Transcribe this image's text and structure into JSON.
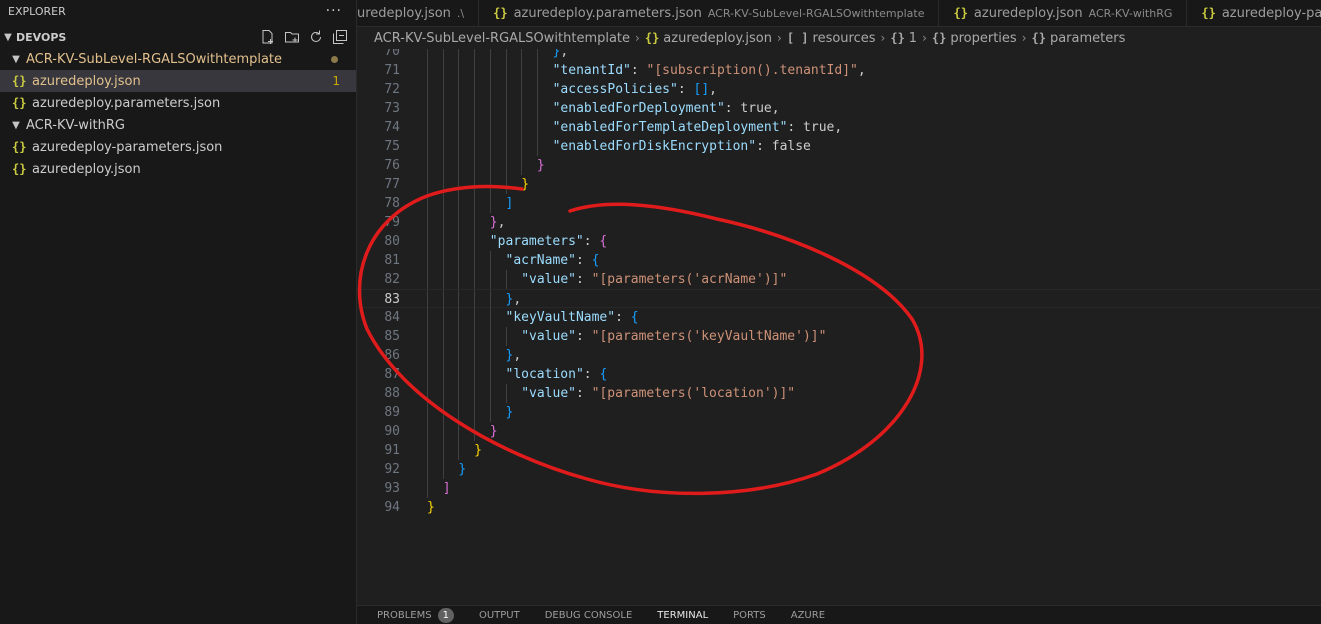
{
  "sidebar": {
    "title": "EXPLORER",
    "more": "···",
    "section": "DEVOPS",
    "tree": [
      {
        "kind": "folder",
        "label": "ACR-KV-SubLevel-RGALSOwithtemplate",
        "modified": true
      },
      {
        "kind": "file",
        "label": "azuredeploy.json",
        "badge": "1",
        "active": true,
        "modified": true
      },
      {
        "kind": "file",
        "label": "azuredeploy.parameters.json"
      },
      {
        "kind": "folder",
        "label": "ACR-KV-withRG"
      },
      {
        "kind": "file",
        "label": "azuredeploy-parameters.json"
      },
      {
        "kind": "file",
        "label": "azuredeploy.json"
      }
    ]
  },
  "tabs": [
    {
      "label": "uredeploy.json",
      "desc": ".\\"
    },
    {
      "label": "azuredeploy.parameters.json",
      "desc": "ACR-KV-SubLevel-RGALSOwithtemplate"
    },
    {
      "label": "azuredeploy.json",
      "desc": "ACR-KV-withRG"
    },
    {
      "label": "azuredeploy-paramete",
      "desc": ""
    }
  ],
  "breadcrumb": {
    "folder": "ACR-KV-SubLevel-RGALSOwithtemplate",
    "file": "azuredeploy.json",
    "resources": "resources",
    "item": "1",
    "properties": "properties",
    "parameters": "parameters"
  },
  "editor": {
    "lines": [
      {
        "n": "70",
        "text": "},"
      },
      {
        "n": "71",
        "text": "\"tenantId\": \"[subscription().tenantId]\","
      },
      {
        "n": "72",
        "text": "\"accessPolicies\": [],"
      },
      {
        "n": "73",
        "text": "\"enabledForDeployment\": true,"
      },
      {
        "n": "74",
        "text": "\"enabledForTemplateDeployment\": true,"
      },
      {
        "n": "75",
        "text": "\"enabledForDiskEncryption\": false"
      },
      {
        "n": "76",
        "text": "}"
      },
      {
        "n": "77",
        "text": "}"
      },
      {
        "n": "78",
        "text": "]"
      },
      {
        "n": "79",
        "text": "},"
      },
      {
        "n": "80",
        "text": "\"parameters\": {"
      },
      {
        "n": "81",
        "text": "\"acrName\": {"
      },
      {
        "n": "82",
        "text": "\"value\": \"[parameters('acrName')]\""
      },
      {
        "n": "83",
        "text": "},"
      },
      {
        "n": "84",
        "text": "\"keyVaultName\": {"
      },
      {
        "n": "85",
        "text": "\"value\": \"[parameters('keyVaultName')]\""
      },
      {
        "n": "86",
        "text": "},"
      },
      {
        "n": "87",
        "text": "\"location\": {"
      },
      {
        "n": "88",
        "text": "\"value\": \"[parameters('location')]\""
      },
      {
        "n": "89",
        "text": "}"
      },
      {
        "n": "90",
        "text": "}"
      },
      {
        "n": "91",
        "text": "}"
      },
      {
        "n": "92",
        "text": "}"
      },
      {
        "n": "93",
        "text": "]"
      },
      {
        "n": "94",
        "text": "}"
      }
    ],
    "current_line": "83"
  },
  "panel": {
    "problems": "PROBLEMS",
    "problems_count": "1",
    "output": "OUTPUT",
    "debug": "DEBUG CONSOLE",
    "terminal": "TERMINAL",
    "ports": "PORTS",
    "azure": "AZURE"
  },
  "colors": {
    "annotation": "#e01b1b",
    "json_icon": "#cbcb41",
    "modified": "#e2c08d"
  }
}
